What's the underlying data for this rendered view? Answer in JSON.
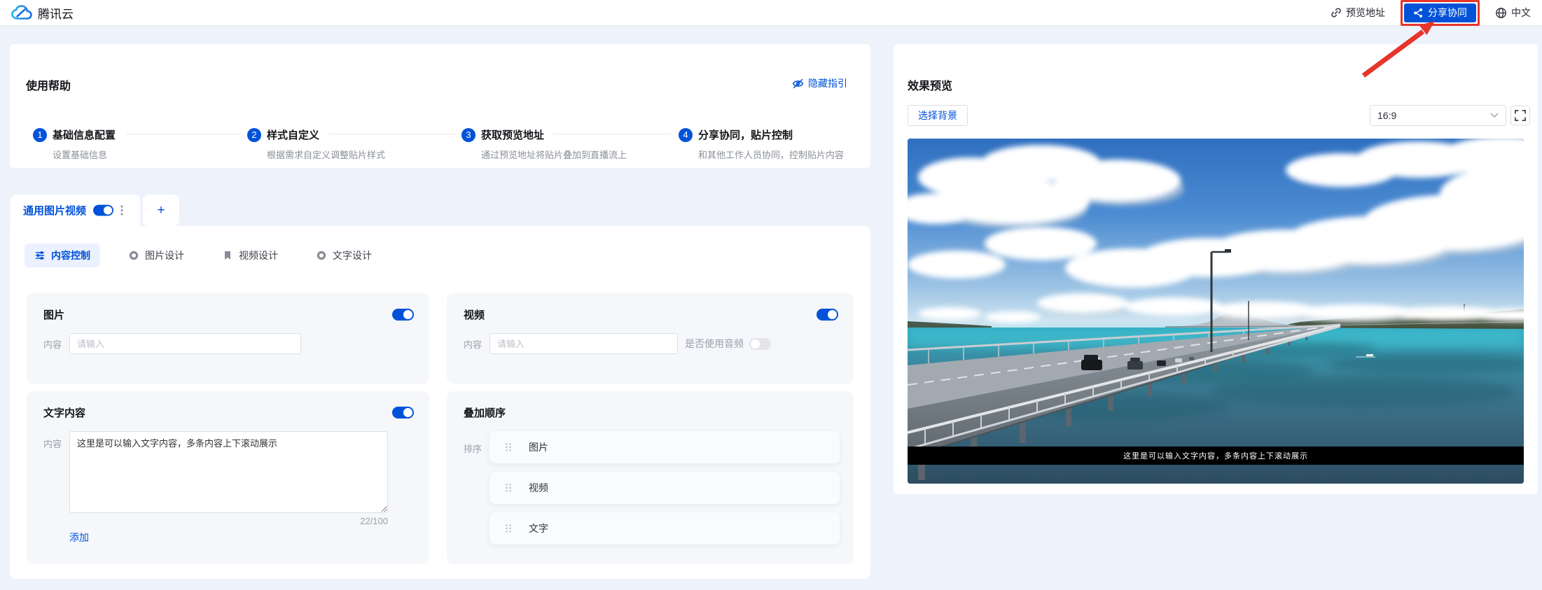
{
  "navbar": {
    "brand": "腾讯云",
    "preview_link": "预览地址",
    "share_button": "分享协同",
    "language": "中文"
  },
  "help": {
    "title": "使用帮助",
    "hide_guide": "隐藏指引",
    "steps": [
      {
        "num": "1",
        "title": "基础信息配置",
        "desc": "设置基础信息"
      },
      {
        "num": "2",
        "title": "样式自定义",
        "desc": "根据需求自定义调整贴片样式"
      },
      {
        "num": "3",
        "title": "获取预览地址",
        "desc": "通过预览地址将贴片叠加到直播流上"
      },
      {
        "num": "4",
        "title": "分享协同，贴片控制",
        "desc": "和其他工作人员协同，控制贴片内容"
      }
    ]
  },
  "editor": {
    "layer_tab": "通用图片视频",
    "layer_tab_enabled": true,
    "add_tab": "+",
    "tabs": [
      {
        "label": "内容控制",
        "active": true
      },
      {
        "label": "图片设计",
        "active": false
      },
      {
        "label": "视频设计",
        "active": false
      },
      {
        "label": "文字设计",
        "active": false
      }
    ],
    "image_card": {
      "title": "图片",
      "label": "内容",
      "placeholder": "请输入",
      "enabled": true
    },
    "video_card": {
      "title": "视频",
      "label": "内容",
      "placeholder": "请输入",
      "audio_label": "是否使用音频",
      "enabled": true,
      "audio_enabled": false
    },
    "text_card": {
      "title": "文字内容",
      "label": "内容",
      "value": "这里是可以输入文字内容，多条内容上下滚动展示",
      "counter": "22/100",
      "add_label": "添加",
      "enabled": true
    },
    "order_card": {
      "title": "叠加顺序",
      "label": "排序",
      "items": [
        "图片",
        "视频",
        "文字"
      ]
    }
  },
  "preview": {
    "title": "效果预览",
    "background_button": "选择背景",
    "ratio": "16:9",
    "overlay_text": "这里是可以输入文字内容，多条内容上下滚动展示"
  },
  "colors": {
    "accent_blue": "#0052d9",
    "annotation_red": "#e6352b",
    "page_bg": "#eef2fb",
    "card_gray": "#f5f7fa",
    "overlay_bar": "#000000"
  }
}
